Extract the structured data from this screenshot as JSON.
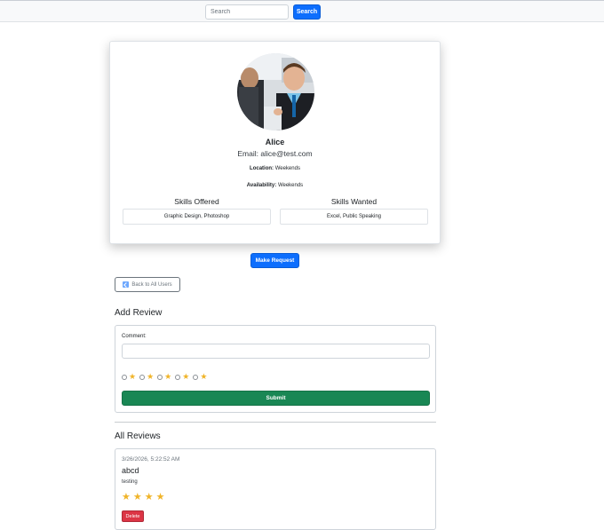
{
  "header": {
    "search_placeholder": "Search",
    "search_button": "Search"
  },
  "profile": {
    "name": "Alice",
    "email": "Email: alice@test.com",
    "location_label": "Location:",
    "location_value": "Weekends",
    "availability_label": "Availability:",
    "availability_value": "Weekends",
    "skills_offered_label": "Skills Offered",
    "skills_offered": "Graphic Design, Photoshop",
    "skills_wanted_label": "Skills Wanted",
    "skills_wanted": "Excel, Public Speaking"
  },
  "actions": {
    "make_request": "Make Request",
    "back_to_users": "Back to All Users"
  },
  "add_review": {
    "title": "Add Review",
    "comment_label": "Comment:",
    "comment_value": "",
    "rating_options": [
      "★",
      "★",
      "★",
      "★",
      "★"
    ],
    "submit": "Submit"
  },
  "all_reviews": {
    "title": "All Reviews",
    "reviews": [
      {
        "date": "3/26/2026, 5:22:52 AM",
        "title": "abcd",
        "text": "testing",
        "rating": 4,
        "delete_label": "Delete"
      }
    ]
  },
  "colors": {
    "primary": "#0d6efd",
    "success": "#198754",
    "danger": "#dc3545",
    "star": "#f0b429"
  }
}
